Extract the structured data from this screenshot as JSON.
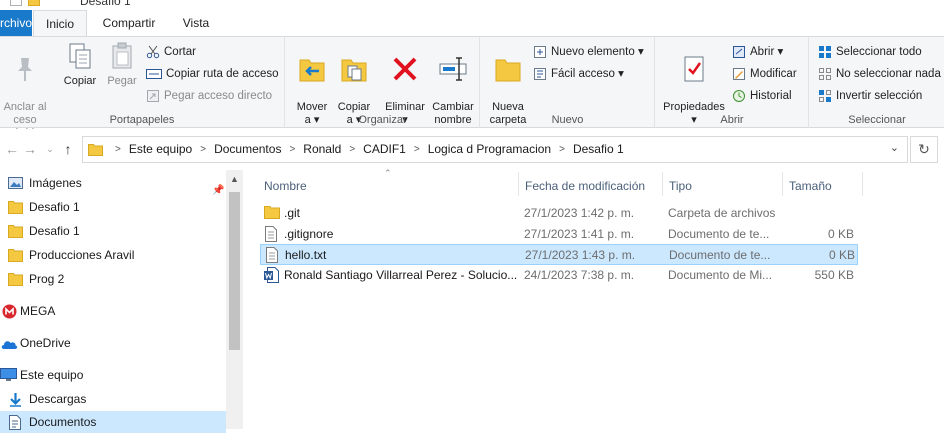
{
  "window": {
    "title": "Desafio 1"
  },
  "ribbon_tabs": [
    "rchivo",
    "Inicio",
    "Compartir",
    "Vista"
  ],
  "ribbon": {
    "portapapeles": {
      "label": "Portapapeles",
      "anclar": "Anclar al\nceso rápido",
      "copiar": "Copiar",
      "pegar": "Pegar",
      "cortar": "Cortar",
      "copiar_ruta": "Copiar ruta de acceso",
      "pegar_acceso": "Pegar acceso directo"
    },
    "organizar": {
      "label": "Organizar",
      "mover": "Mover\na ▾",
      "copiar": "Copiar\na ▾",
      "eliminar": "Eliminar\n▾",
      "cambiar": "Cambiar\nnombre"
    },
    "nuevo": {
      "label": "Nuevo",
      "nueva_carpeta": "Nueva\ncarpeta",
      "nuevo_elemento": "Nuevo elemento ▾",
      "facil_acceso": "Fácil acceso ▾"
    },
    "abrir": {
      "label": "Abrir",
      "propiedades": "Propiedades\n▾",
      "abrir": "Abrir ▾",
      "modificar": "Modificar",
      "historial": "Historial"
    },
    "seleccionar": {
      "label": "Seleccionar",
      "todo": "Seleccionar todo",
      "nada": "No seleccionar nada",
      "invertir": "Invertir selección"
    }
  },
  "address": {
    "breadcrumbs": [
      "Este equipo",
      "Documentos",
      "Ronald",
      "CADIF1",
      "Logica d Programacion",
      "Desafio 1"
    ]
  },
  "nav": {
    "items": [
      {
        "label": "Imágenes",
        "icon": "pictures-icon"
      },
      {
        "label": "Desafio 1",
        "icon": "folder-icon"
      },
      {
        "label": "Desafio 1",
        "icon": "folder-icon"
      },
      {
        "label": "Producciones Aravil",
        "icon": "folder-icon"
      },
      {
        "label": "Prog 2",
        "icon": "folder-icon"
      },
      {
        "label": "MEGA",
        "icon": "mega-icon"
      },
      {
        "label": "OneDrive",
        "icon": "onedrive-icon"
      },
      {
        "label": "Este equipo",
        "icon": "this-pc-icon"
      },
      {
        "label": "Descargas",
        "icon": "downloads-icon"
      },
      {
        "label": "Documentos",
        "icon": "documents-icon"
      }
    ]
  },
  "files": {
    "columns": {
      "name": "Nombre",
      "date": "Fecha de modificación",
      "type": "Tipo",
      "size": "Tamaño"
    },
    "rows": [
      {
        "name": ".git",
        "date": "27/1/2023 1:42 p. m.",
        "type": "Carpeta de archivos",
        "size": "",
        "icon": "folder-icon"
      },
      {
        "name": ".gitignore",
        "date": "27/1/2023 1:41 p. m.",
        "type": "Documento de te...",
        "size": "0 KB",
        "icon": "text-file-icon"
      },
      {
        "name": "hello.txt",
        "date": "27/1/2023 1:43 p. m.",
        "type": "Documento de te...",
        "size": "0 KB",
        "icon": "text-file-icon"
      },
      {
        "name": "Ronald Santiago Villarreal Perez - Solucio...",
        "date": "24/1/2023 7:38 p. m.",
        "type": "Documento de Mi...",
        "size": "550 KB",
        "icon": "word-doc-icon"
      }
    ]
  },
  "colors": {
    "accent": "#1979ca",
    "selection": "#cce8ff",
    "folder": "#f5c842"
  }
}
